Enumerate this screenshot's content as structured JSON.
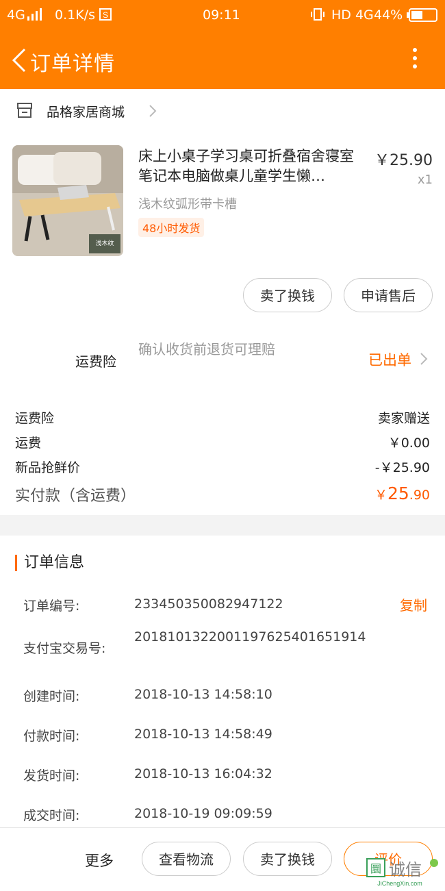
{
  "status": {
    "network": "4G",
    "speed": "0.1K/s",
    "time": "09:11",
    "right": "HD 4G",
    "battery": "44%"
  },
  "header": {
    "title": "订单详情"
  },
  "shop": {
    "name": "品格家居商城"
  },
  "product": {
    "title": "床上小桌子学习桌可折叠宿舍寝室笔记本电脑做桌儿童学生懒…",
    "price": "￥25.90",
    "qty": "x1",
    "sku": "浅木纹弧形带卡槽",
    "tag": "48小时发货",
    "thumb_label": "浅木纹",
    "buttons": [
      "卖了换钱",
      "申请售后"
    ]
  },
  "insurance": {
    "label": "运费险",
    "desc": "确认收货前退货可理赔",
    "status": "已出单"
  },
  "fees": [
    {
      "label": "运费险",
      "value": "卖家赠送"
    },
    {
      "label": "运费",
      "value": "￥0.00"
    },
    {
      "label": "新品抢鲜价",
      "value": "-￥25.90"
    }
  ],
  "total": {
    "label": "实付款（含运费）",
    "currency": "￥",
    "int": "25",
    "dec": ".90"
  },
  "order_info": {
    "title": "订单信息",
    "copy": "复制",
    "rows": [
      {
        "label": "订单编号:",
        "value": "233450350082947122"
      },
      {
        "label": "支付宝交易号:",
        "value": "2018101322001197625401651914"
      },
      {
        "label": "创建时间:",
        "value": "2018-10-13 14:58:10"
      },
      {
        "label": "付款时间:",
        "value": "2018-10-13 14:58:49"
      },
      {
        "label": "发货时间:",
        "value": "2018-10-13 16:04:32"
      },
      {
        "label": "成交时间:",
        "value": "2018-10-19 09:09:59"
      }
    ]
  },
  "bottom": {
    "more": "更多",
    "buttons": [
      "查看物流",
      "卖了换钱",
      "评价"
    ]
  },
  "watermark": {
    "text": "诚信",
    "sub": "JiChengXin.com"
  },
  "colors": {
    "accent": "#ff7f00",
    "price": "#ff5a00"
  }
}
